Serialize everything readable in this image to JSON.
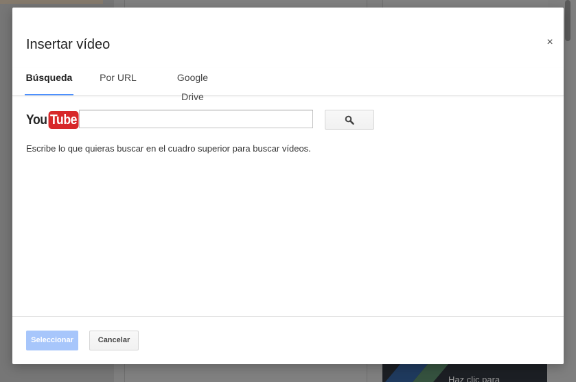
{
  "background": {
    "partial_text": "Haz clic para"
  },
  "dialog": {
    "title": "Insertar vídeo",
    "close_symbol": "×"
  },
  "tabs": [
    {
      "label": "Búsqueda",
      "active": true
    },
    {
      "label": "Por URL",
      "active": false
    },
    {
      "label": "Google Drive",
      "active": false
    }
  ],
  "search": {
    "logo_you": "You",
    "logo_tube": "Tube",
    "value": "",
    "placeholder": "",
    "button_icon": "search-icon",
    "hint": "Escribe lo que quieras buscar en el cuadro superior para buscar vídeos."
  },
  "footer": {
    "select_label": "Seleccionar",
    "cancel_label": "Cancelar"
  },
  "colors": {
    "accent": "#4d90fe",
    "select_disabled": "#a7c6fb",
    "youtube_red": "#d7282a"
  }
}
